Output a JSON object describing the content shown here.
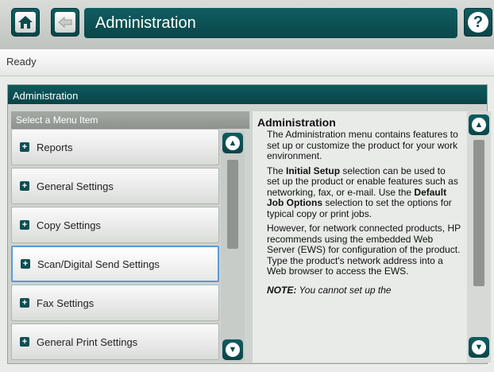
{
  "header": {
    "title": "Administration",
    "home_icon": "home-icon",
    "back_icon": "back-arrow-icon",
    "help_icon": "help-icon",
    "help_glyph": "?"
  },
  "status": {
    "text": "Ready"
  },
  "panel": {
    "title": "Administration",
    "list_header": "Select a Menu Item",
    "items": [
      {
        "label": "Reports",
        "selected": false
      },
      {
        "label": "General Settings",
        "selected": false
      },
      {
        "label": "Copy Settings",
        "selected": false
      },
      {
        "label": "Scan/Digital Send Settings",
        "selected": true
      },
      {
        "label": "Fax Settings",
        "selected": false
      },
      {
        "label": "General Print Settings",
        "selected": false
      }
    ]
  },
  "help_text": {
    "heading": "Administration",
    "p1": "The Administration menu contains features to set up or customize the product for your work environment.",
    "p2_a": "The ",
    "p2_b1": "Initial Setup",
    "p2_c": " selection can be used to set up the product or enable features such as networking, fax, or e-mail. Use the ",
    "p2_b2": "Default Job Options",
    "p2_d": " selection to set the options for typical copy or print jobs.",
    "p3": "However, for network connected products, HP recommends using the embedded Web Server (EWS) for configuration of the product. Type the product's network address into a Web browser to access the EWS.",
    "note_label": "NOTE:",
    "note_text": " You cannot set up the"
  },
  "colors": {
    "accent": "#0b4b4f",
    "selection": "#5b9bd5"
  }
}
